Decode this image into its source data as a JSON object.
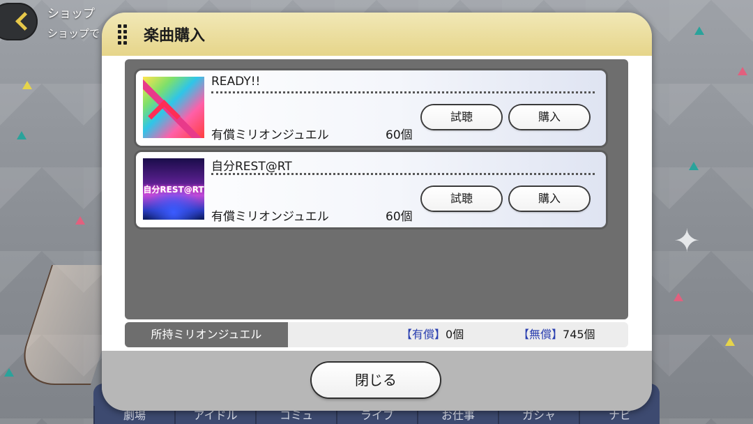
{
  "header": {
    "title": "ショップ",
    "subtitle": "ショップで"
  },
  "bottom_nav": [
    "劇場",
    "アイドル",
    "コミュ",
    "ライブ",
    "お仕事",
    "ガシャ",
    "ナビ"
  ],
  "dialog": {
    "title": "楽曲購入",
    "songs": [
      {
        "name": "READY!!",
        "jacket_text": "",
        "currency": "有償ミリオンジュエル",
        "price": "60個",
        "preview_label": "試聴",
        "buy_label": "購入"
      },
      {
        "name": "自分REST@RT",
        "jacket_text": "自分REST@RT",
        "currency": "有償ミリオンジュエル",
        "price": "60個",
        "preview_label": "試聴",
        "buy_label": "購入"
      }
    ],
    "jewels": {
      "label": "所持ミリオンジュエル",
      "paid_tag": "【有償】",
      "paid_value": "0個",
      "free_tag": "【無償】",
      "free_value": "745個"
    },
    "close_label": "閉じる"
  },
  "colors": {
    "header_gold": "#e6d58a",
    "list_bg": "#6e6e6e",
    "bracket_blue": "#2a3fb0"
  }
}
